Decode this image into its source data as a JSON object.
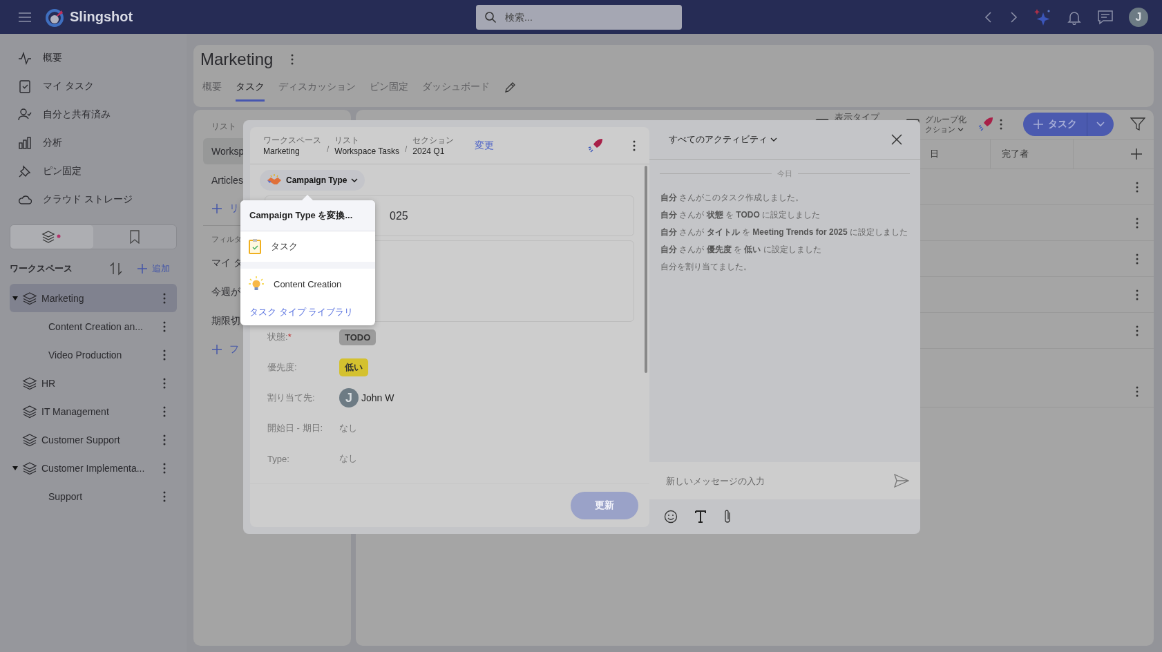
{
  "topbar": {
    "app_name": "Slingshot",
    "search": {
      "placeholder": "検索..."
    },
    "avatar": "J"
  },
  "sidebar": {
    "nav": [
      {
        "label": "概要"
      },
      {
        "label": "マイ タスク"
      },
      {
        "label": "自分と共有済み"
      },
      {
        "label": "分析"
      },
      {
        "label": "ピン固定"
      },
      {
        "label": "クラウド ストレージ"
      }
    ],
    "view_toggle": [
      {
        "selected": true
      },
      {
        "selected": false
      }
    ],
    "workspaces_title": "ワークスペース",
    "add_label": "追加",
    "tree": [
      {
        "label": "Marketing",
        "selected": true,
        "expanded": true,
        "children": [
          {
            "label": "Content Creation an...",
            "selected": false
          },
          {
            "label": "Video Production",
            "selected": false
          }
        ]
      },
      {
        "label": "HR",
        "selected": false,
        "expanded": false
      },
      {
        "label": "IT Management",
        "selected": false,
        "expanded": false
      },
      {
        "label": "Customer Support",
        "selected": false,
        "expanded": false
      },
      {
        "label": "Customer Implementa...",
        "selected": false,
        "expanded": true,
        "children": [
          {
            "label": "Support",
            "selected": false
          }
        ]
      }
    ]
  },
  "page": {
    "title": "Marketing",
    "tabs": [
      {
        "label": "概要",
        "selected": false
      },
      {
        "label": "タスク",
        "selected": true
      },
      {
        "label": "ディスカッション",
        "selected": false
      },
      {
        "label": "ピン固定",
        "selected": false
      },
      {
        "label": "ダッシュボード",
        "selected": false
      }
    ]
  },
  "lists_panel": {
    "title": "リスト",
    "lists": [
      {
        "label": "Worksp",
        "selected": true
      },
      {
        "label": "Articles",
        "selected": false
      }
    ],
    "add_list": "リ",
    "filters_title": "フィルタ",
    "filters": [
      {
        "label": "マイ タ"
      },
      {
        "label": "今週が"
      },
      {
        "label": "期限切"
      }
    ],
    "add_filter": "フ"
  },
  "toolbar": {
    "view_type": "表示タイプ",
    "group_by": "グループ化",
    "group_value": "クション",
    "new_task": "タスク"
  },
  "table": {
    "columns": [
      "日",
      "完了者"
    ],
    "rows": [
      {
        "kind": "task"
      },
      {
        "kind": "task"
      },
      {
        "kind": "task"
      },
      {
        "kind": "task"
      },
      {
        "kind": "task"
      },
      {
        "kind": "group"
      }
    ]
  },
  "task_modal": {
    "breadcrumb": [
      {
        "label": "ワークスペース",
        "value": "Marketing"
      },
      {
        "separator": "/",
        "label": "リスト",
        "value": "Workspace Tasks"
      },
      {
        "separator": "/",
        "label": "セクション",
        "value": "2024 Q1"
      }
    ],
    "change_link": "変更",
    "task_type": "Campaign Type",
    "title_value": "025",
    "fields": [
      {
        "label": "状態:",
        "required_mark": "*",
        "kind": "chip",
        "value": "TODO",
        "color": "#9b9b9b"
      },
      {
        "label": "優先度:",
        "kind": "chip",
        "value": "低い",
        "color": "#d4c12f"
      },
      {
        "label": "割り当て先:",
        "kind": "user",
        "value": "John W",
        "avatar": "J"
      },
      {
        "label": "開始日 - 期日:",
        "kind": "text",
        "value": "なし"
      },
      {
        "label": "Type:",
        "kind": "text",
        "value": "なし"
      }
    ],
    "update_button": {
      "label": "更新",
      "disabled": true
    }
  },
  "activity": {
    "filter": "すべてのアクティビティ",
    "date_divider": "今日",
    "entries": [
      "**自分** さんがこのタスク作成しました。",
      "**自分** さんが **状態** を **TODO** に設定しました",
      "**自分** さんが **タイトル** を **Meeting Trends for 2025** に設定しました",
      "**自分** さんが **優先度** を **低い** に設定しました",
      "自分を割り当てました。"
    ],
    "message_placeholder": "新しいメッセージの入力"
  },
  "type_menu": {
    "title": "Campaign Type を変換...",
    "options": [
      {
        "label": "タスク"
      },
      {
        "label": "Content Creation"
      }
    ],
    "library_link": "タスク タイプ ライブラリ"
  }
}
